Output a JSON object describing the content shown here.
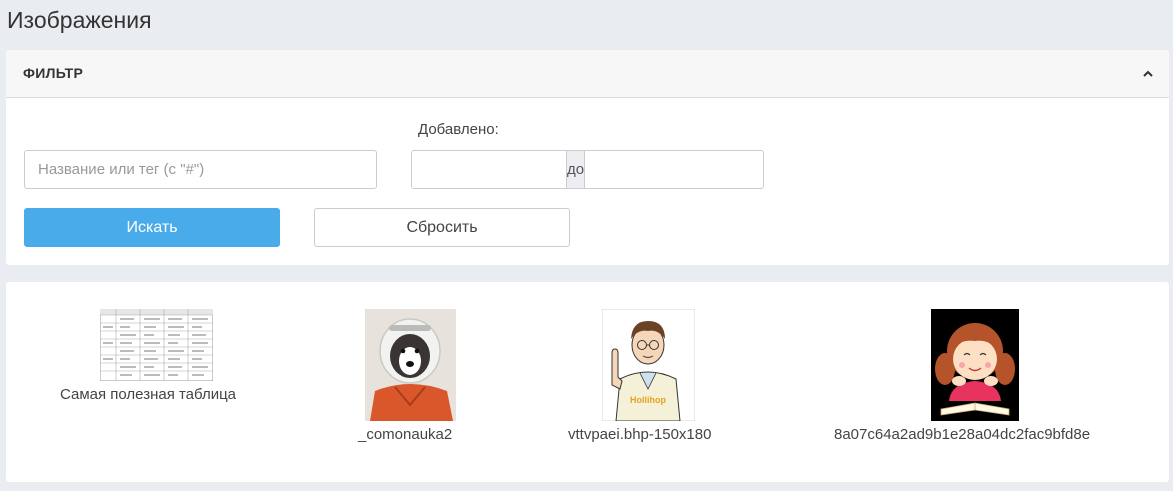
{
  "page": {
    "title": "Изображения"
  },
  "filter": {
    "title": "ФИЛЬТР",
    "search_placeholder": "Название или тег (с \"#\")",
    "added_label": "Добавлено:",
    "date_from_value": "",
    "date_separator": "до",
    "date_to_value": "",
    "search_button": "Искать",
    "reset_button": "Сбросить"
  },
  "colors": {
    "accent": "#4aabea",
    "background": "#e9ecf0"
  },
  "images": [
    {
      "caption": "Самая полезная таблица",
      "icon": "table-thumbnail"
    },
    {
      "caption": "_comonauka2",
      "icon": "astronaut-dog-thumbnail"
    },
    {
      "caption": "vttvpaei.bhp-150x180",
      "icon": "teacher-cartoon-thumbnail"
    },
    {
      "caption": "8a07c64a2ad9b1e28a04dc2fac9bfd8e",
      "icon": "girl-reading-thumbnail"
    }
  ]
}
